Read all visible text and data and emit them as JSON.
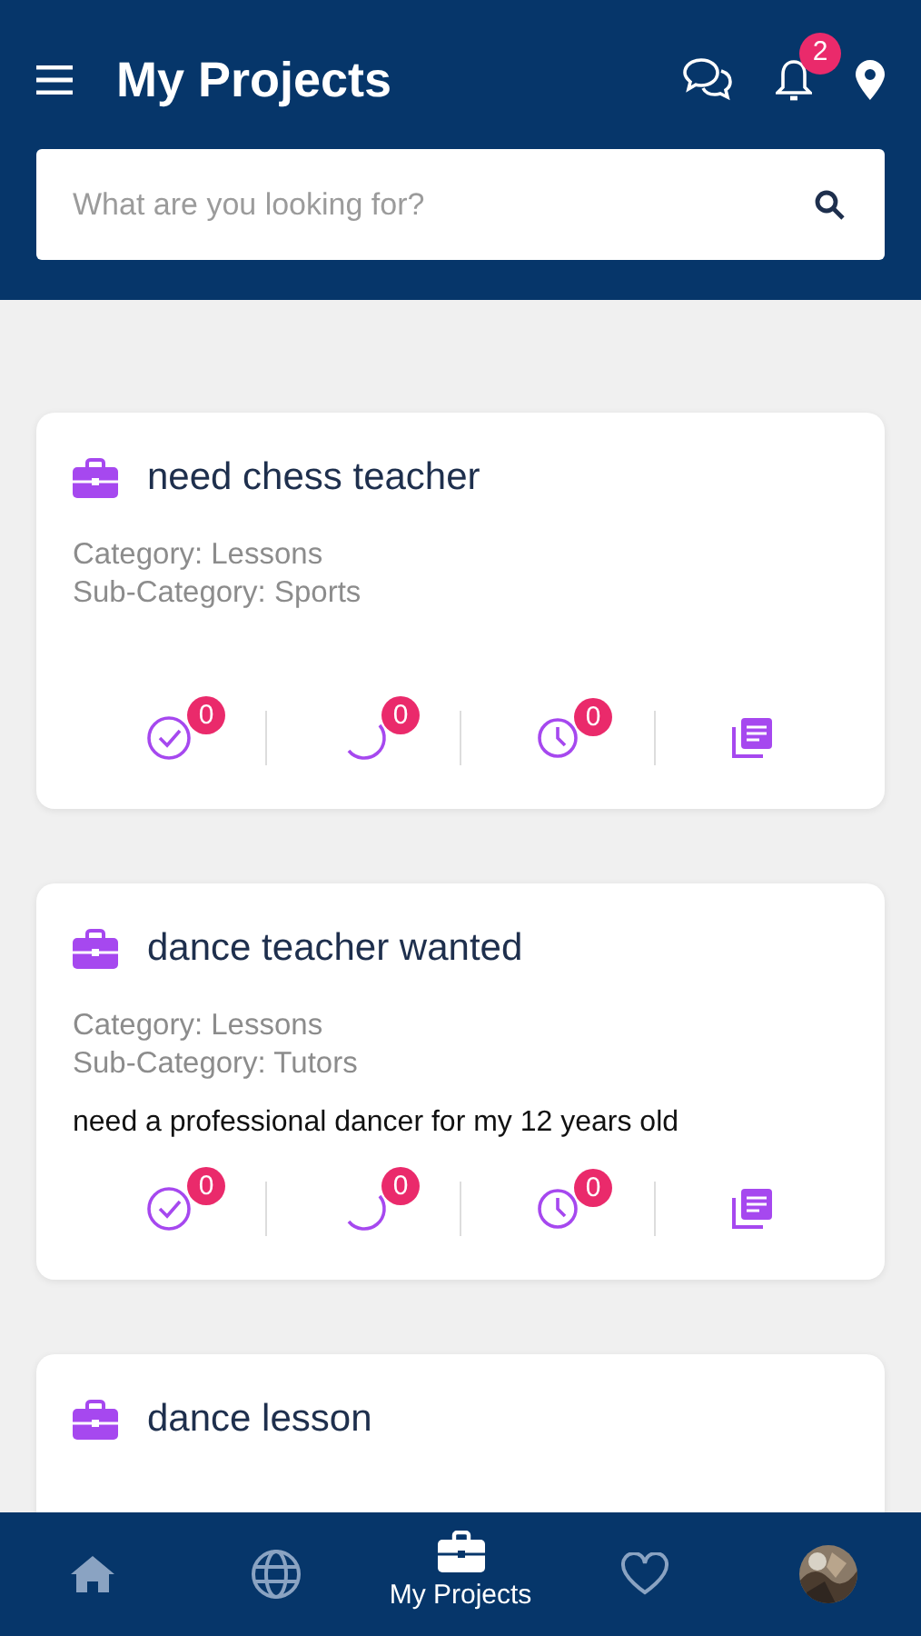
{
  "header": {
    "title": "My Projects",
    "notification_count": "2"
  },
  "search": {
    "placeholder": "What are you looking for?"
  },
  "projects": [
    {
      "title": "need chess teacher",
      "category": "Category: Lessons",
      "subcategory": "Sub-Category: Sports",
      "stats": [
        {
          "kind": "done",
          "count": "0"
        },
        {
          "kind": "progress",
          "count": "0"
        },
        {
          "kind": "pending",
          "count": "0"
        },
        {
          "kind": "docs"
        }
      ]
    },
    {
      "title": "dance teacher wanted",
      "category": "Category: Lessons",
      "subcategory": "Sub-Category: Tutors",
      "description": "need a professional dancer for my 12 years old",
      "stats": [
        {
          "kind": "done",
          "count": "0"
        },
        {
          "kind": "progress",
          "count": "0"
        },
        {
          "kind": "pending",
          "count": "0"
        },
        {
          "kind": "docs"
        }
      ]
    },
    {
      "title": "dance lesson"
    }
  ],
  "tabbar": [
    {
      "kind": "home",
      "selected": false
    },
    {
      "kind": "globe",
      "selected": false
    },
    {
      "kind": "projects",
      "label": "My Projects",
      "selected": true
    },
    {
      "kind": "heart",
      "selected": false
    },
    {
      "kind": "avatar",
      "selected": false
    }
  ]
}
